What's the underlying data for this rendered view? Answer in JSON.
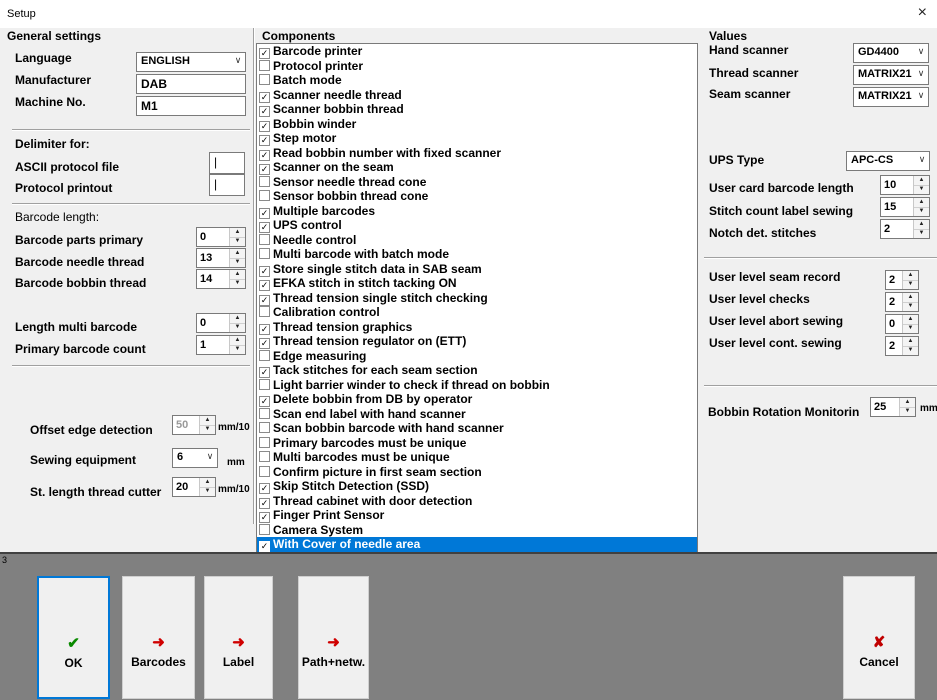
{
  "window": {
    "title": "Setup",
    "close_icon": "×"
  },
  "general": {
    "group_title": "General settings",
    "language_label": "Language",
    "language_value": "ENGLISH",
    "manufacturer_label": "Manufacturer",
    "manufacturer_value": "DAB",
    "machine_label": "Machine No.",
    "machine_value": "M1",
    "delimiter_title": "Delimiter for:",
    "ascii_label": "ASCII protocol file",
    "ascii_value": "|",
    "printout_label": "Protocol printout",
    "printout_value": "|",
    "barcode_length_title": "Barcode length:",
    "parts_primary_label": "Barcode parts primary",
    "parts_primary_value": "0",
    "needle_thread_label": "Barcode needle thread",
    "needle_thread_value": "13",
    "bobbin_thread_label": "Barcode bobbin thread",
    "bobbin_thread_value": "14",
    "length_multi_label": "Length multi barcode",
    "length_multi_value": "0",
    "primary_count_label": "Primary barcode count",
    "primary_count_value": "1",
    "offset_label": "Offset edge detection",
    "offset_value": "50",
    "offset_unit": "mm/10",
    "sewing_label": "Sewing equipment",
    "sewing_value": "6",
    "sewing_unit": "mm",
    "stlength_label": "St. length thread cutter",
    "stlength_value": "20",
    "stlength_unit": "mm/10"
  },
  "components": {
    "group_title": "Components",
    "items": [
      {
        "label": "Barcode printer",
        "checked": true
      },
      {
        "label": "Protocol printer",
        "checked": false
      },
      {
        "label": "Batch mode",
        "checked": false
      },
      {
        "label": "Scanner needle thread",
        "checked": true
      },
      {
        "label": "Scanner bobbin thread",
        "checked": true
      },
      {
        "label": "Bobbin winder",
        "checked": true
      },
      {
        "label": "Step motor",
        "checked": true
      },
      {
        "label": "Read bobbin number with fixed scanner",
        "checked": true
      },
      {
        "label": "Scanner on the seam",
        "checked": true
      },
      {
        "label": "Sensor needle thread cone",
        "checked": false
      },
      {
        "label": "Sensor bobbin thread cone",
        "checked": false
      },
      {
        "label": "Multiple barcodes",
        "checked": true
      },
      {
        "label": "UPS control",
        "checked": true
      },
      {
        "label": "Needle control",
        "checked": false
      },
      {
        "label": "Multi barcode with batch mode",
        "checked": false
      },
      {
        "label": "Store single stitch data in SAB seam",
        "checked": true
      },
      {
        "label": "EFKA stitch in stitch tacking ON",
        "checked": true
      },
      {
        "label": "Thread tension single stitch checking",
        "checked": true
      },
      {
        "label": "Calibration control",
        "checked": false
      },
      {
        "label": "Thread tension graphics",
        "checked": true
      },
      {
        "label": "Thread tension regulator on (ETT)",
        "checked": true
      },
      {
        "label": "Edge measuring",
        "checked": false
      },
      {
        "label": "Tack stitches for each seam section",
        "checked": true
      },
      {
        "label": "Light barrier winder to check if thread on bobbin",
        "checked": false
      },
      {
        "label": "Delete bobbin from DB by operator",
        "checked": true
      },
      {
        "label": "Scan end label with hand scanner",
        "checked": false
      },
      {
        "label": "Scan bobbin barcode with hand scanner",
        "checked": false
      },
      {
        "label": "Primary barcodes must be unique",
        "checked": false
      },
      {
        "label": "Multi barcodes must be unique",
        "checked": false
      },
      {
        "label": "Confirm picture in first seam section",
        "checked": false
      },
      {
        "label": "Skip Stitch Detection (SSD)",
        "checked": true
      },
      {
        "label": "Thread cabinet with door detection",
        "checked": true
      },
      {
        "label": "Finger Print Sensor",
        "checked": true
      },
      {
        "label": "Camera System",
        "checked": false
      },
      {
        "label": "With Cover of needle area",
        "checked": true,
        "selected": true
      }
    ]
  },
  "values": {
    "group_title": "Values",
    "hand_scanner_label": "Hand scanner",
    "hand_scanner_value": "GD4400",
    "thread_scanner_label": "Thread scanner",
    "thread_scanner_value": "MATRIX21",
    "seam_scanner_label": "Seam scanner",
    "seam_scanner_value": "MATRIX21",
    "ups_label": "UPS Type",
    "ups_value": "APC-CS",
    "user_card_label": "User card barcode length",
    "user_card_value": "10",
    "stitch_label_label": "Stitch count label sewing",
    "stitch_label_value": "15",
    "notch_label": "Notch det. stitches",
    "notch_value": "2",
    "ul_seam_label": "User level seam record",
    "ul_seam_value": "2",
    "ul_checks_label": "User level checks",
    "ul_checks_value": "2",
    "ul_abort_label": "User level abort sewing",
    "ul_abort_value": "0",
    "ul_cont_label": "User level cont. sewing",
    "ul_cont_value": "2",
    "bobbin_rot_label": "Bobbin Rotation Monitorin",
    "bobbin_rot_value": "25",
    "bobbin_rot_unit": "mm"
  },
  "bottom": {
    "panel_number": "3",
    "ok_label": "OK",
    "barcodes_label": "Barcodes",
    "label_label": "Label",
    "path_label": "Path+netw.",
    "cancel_label": "Cancel",
    "colors": {
      "panel": "#808080",
      "accent_blue": "#0078d7",
      "ok_green": "#0a8a00",
      "arrow_red": "#d00000",
      "cancel_red": "#c00000"
    }
  }
}
